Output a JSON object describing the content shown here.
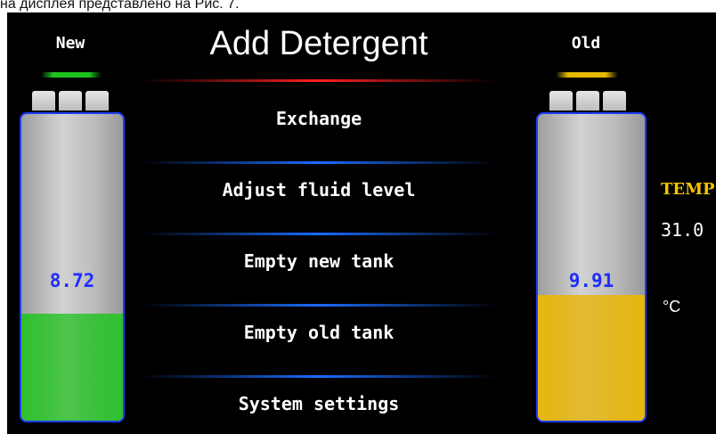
{
  "caption": "на дисплея представлено на Рис. 7.",
  "title": "Add Detergent",
  "new_tank": {
    "label": "New",
    "value": "8.72",
    "fill_fraction": 0.35,
    "fill_color": "#2ec22e",
    "indicator_color": "#1fc11f"
  },
  "old_tank": {
    "label": "Old",
    "value": "9.91",
    "fill_fraction": 0.41,
    "fill_color": "#e7b70f",
    "indicator_color": "#e6b800"
  },
  "menu": [
    {
      "label": "Exchange"
    },
    {
      "label": "Adjust fluid level"
    },
    {
      "label": "Empty new tank"
    },
    {
      "label": "Empty old tank"
    },
    {
      "label": "System settings"
    }
  ],
  "temperature": {
    "label": "TEMP",
    "value": "31.0",
    "unit": "°C"
  },
  "colors": {
    "screen_bg": "#000000",
    "title_underline": "#ff2020",
    "menu_separator": "#1a6cff",
    "tank_border": "#1e3cff",
    "tank_value_text": "#1f2dff",
    "temp_label": "#f5c400"
  }
}
